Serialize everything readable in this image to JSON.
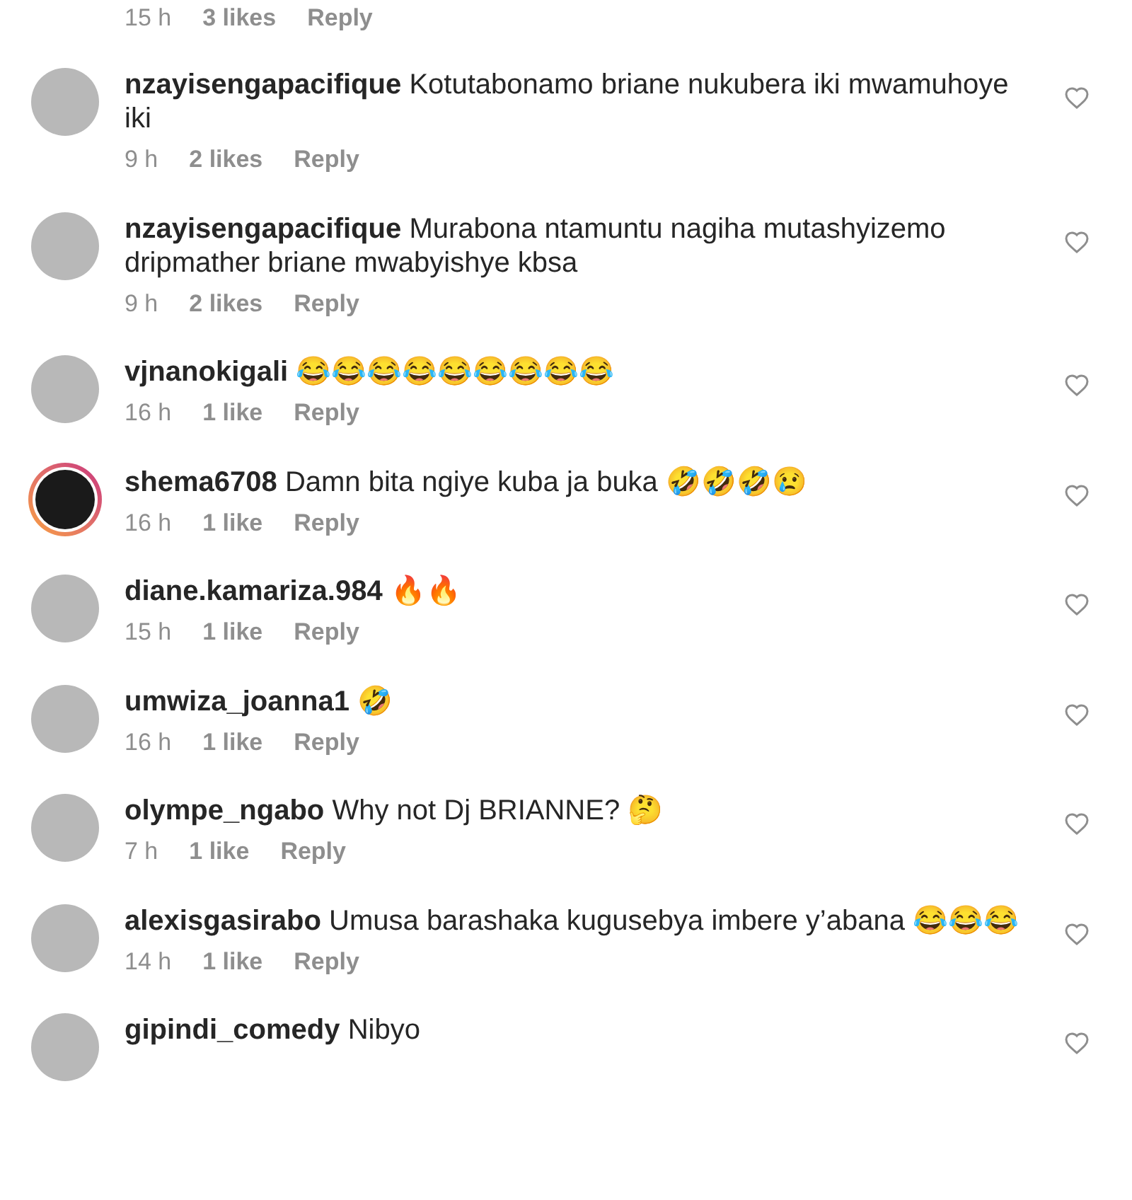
{
  "top_partial": {
    "time": "15 h",
    "likes": "3 likes",
    "reply": "Reply"
  },
  "comments": [
    {
      "username": "nzayisengapacifique",
      "text": "Kotutabonamo briane nukubera iki mwamuhoye iki",
      "time": "9 h",
      "likes": "2 likes",
      "reply": "Reply",
      "story_ring": false
    },
    {
      "username": "nzayisengapacifique",
      "text": "Murabona ntamuntu nagiha mutashyizemo dripmather briane mwabyishye kbsa",
      "time": "9 h",
      "likes": "2 likes",
      "reply": "Reply",
      "story_ring": false
    },
    {
      "username": "vjnanokigali",
      "text": "😂😂😂😂😂😂😂😂😂",
      "time": "16 h",
      "likes": "1 like",
      "reply": "Reply",
      "story_ring": false
    },
    {
      "username": "shema6708",
      "text": "Damn bita ngiye kuba ja buka 🤣🤣🤣😢",
      "time": "16 h",
      "likes": "1 like",
      "reply": "Reply",
      "story_ring": true
    },
    {
      "username": "diane.kamariza.984",
      "text": "🔥🔥",
      "time": "15 h",
      "likes": "1 like",
      "reply": "Reply",
      "story_ring": false
    },
    {
      "username": "umwiza_joanna1",
      "text": "🤣",
      "time": "16 h",
      "likes": "1 like",
      "reply": "Reply",
      "story_ring": false
    },
    {
      "username": "olympe_ngabo",
      "text": "Why not Dj BRIANNE? 🤔",
      "time": "7 h",
      "likes": "1 like",
      "reply": "Reply",
      "story_ring": false
    },
    {
      "username": "alexisgasirabo",
      "text": "Umusa barashaka kugusebya imbere y’abana 😂😂😂",
      "time": "14 h",
      "likes": "1 like",
      "reply": "Reply",
      "story_ring": false
    },
    {
      "username": "gipindi_comedy",
      "text": "Nibyo",
      "story_ring": false
    }
  ]
}
